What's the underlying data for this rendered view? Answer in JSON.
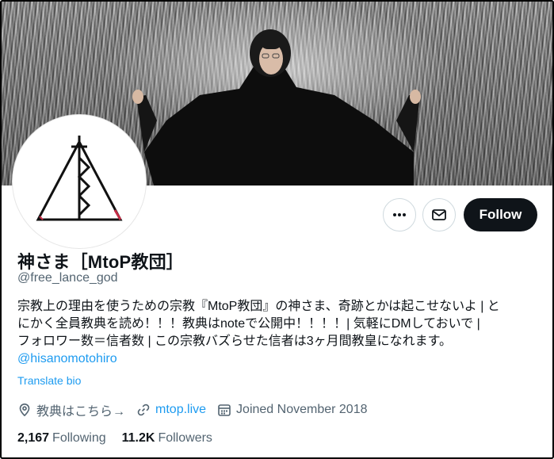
{
  "profile": {
    "name": "神さま［MtoP教団］",
    "handle": "@free_lance_god",
    "bio_line1": "宗教上の理由を使うための宗教『MtoP教団』の神さま、奇跡とかは起こせないよ | と",
    "bio_line2": "にかく全員教典を読め！！！教典はnoteで公開中！！！！| 気軽にDMしておいで |",
    "bio_line3": "フォロワー数＝信者数 | この宗教バズらせた信者は3ヶ月間教皇になれます。",
    "bio_mention": "@hisanomotohiro",
    "translate_label": "Translate bio",
    "location": "教典はこちら→",
    "website": "mtop.live",
    "joined": "Joined November 2018",
    "following_count": "2,167",
    "following_label": "Following",
    "followers_count": "11.2K",
    "followers_label": "Followers"
  },
  "actions": {
    "follow_label": "Follow"
  },
  "icons": {
    "more": "more-icon",
    "message": "envelope-icon",
    "location": "location-pin-icon",
    "link": "link-icon",
    "calendar": "calendar-icon"
  },
  "colors": {
    "accent": "#1d9bf0",
    "text": "#0f1419",
    "secondary": "#536471",
    "follow_bg": "#0f1419"
  }
}
